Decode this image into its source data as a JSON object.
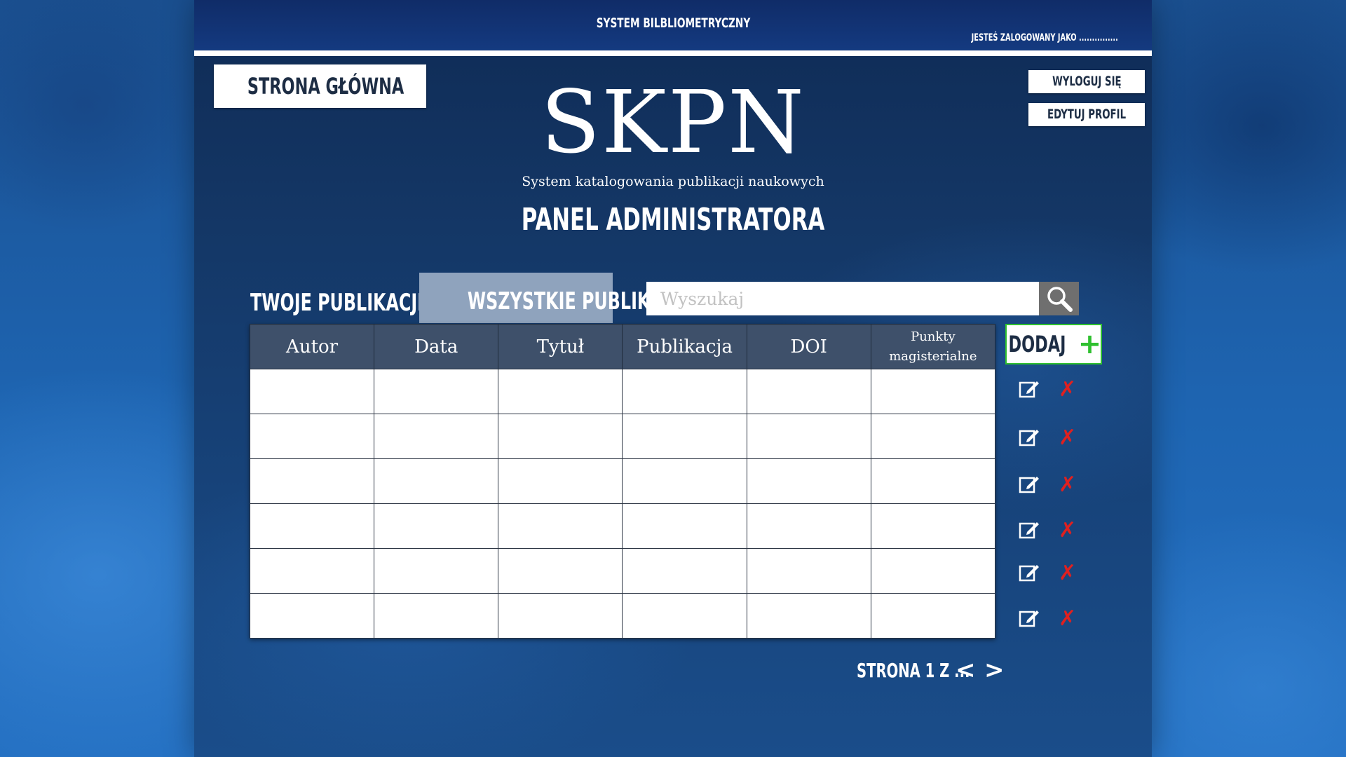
{
  "header": {
    "system_title": "SYSTEM BILBLIOMETRYCZNY",
    "logged_in_as": "JESTEŚ ZALOGOWANY JAKO ..............."
  },
  "nav": {
    "home_label": "STRONA GŁÓWNA",
    "logout_label": "WYLOGUJ SIĘ",
    "edit_profile_label": "EDYTUJ PROFIL"
  },
  "logo": {
    "title": "SKPN",
    "subtitle": "System katalogowania publikacji naukowych"
  },
  "panel_title": "PANEL ADMINISTRATORA",
  "tabs": [
    {
      "label": "TWOJE PUBLIKACJE",
      "active": false
    },
    {
      "label": "WSZYSTKIE PUBLIKACJE",
      "active": true
    }
  ],
  "search": {
    "placeholder": "Wyszukaj",
    "value": ""
  },
  "table": {
    "columns": [
      "Autor",
      "Data",
      "Tytuł",
      "Publikacja",
      "DOI",
      "Punkty magisterialne"
    ],
    "rows": [
      [
        "",
        "",
        "",
        "",
        "",
        ""
      ],
      [
        "",
        "",
        "",
        "",
        "",
        ""
      ],
      [
        "",
        "",
        "",
        "",
        "",
        ""
      ],
      [
        "",
        "",
        "",
        "",
        "",
        ""
      ],
      [
        "",
        "",
        "",
        "",
        "",
        ""
      ],
      [
        "",
        "",
        "",
        "",
        "",
        ""
      ]
    ]
  },
  "actions": {
    "add_label": "DODAJ",
    "add_icon": "plus-icon",
    "edit_icon": "edit-icon",
    "delete_icon": "delete-icon",
    "delete_glyph": "✗"
  },
  "pagination": {
    "label": "STRONA 1 Z ...",
    "prev": "<",
    "next": ">"
  },
  "colors": {
    "header_bg": "#143a80",
    "header_row_bg": "#3e506a",
    "active_tab_bg": "#8fa3bd",
    "add_border": "#2fc02f",
    "delete_color": "#e0201f"
  }
}
